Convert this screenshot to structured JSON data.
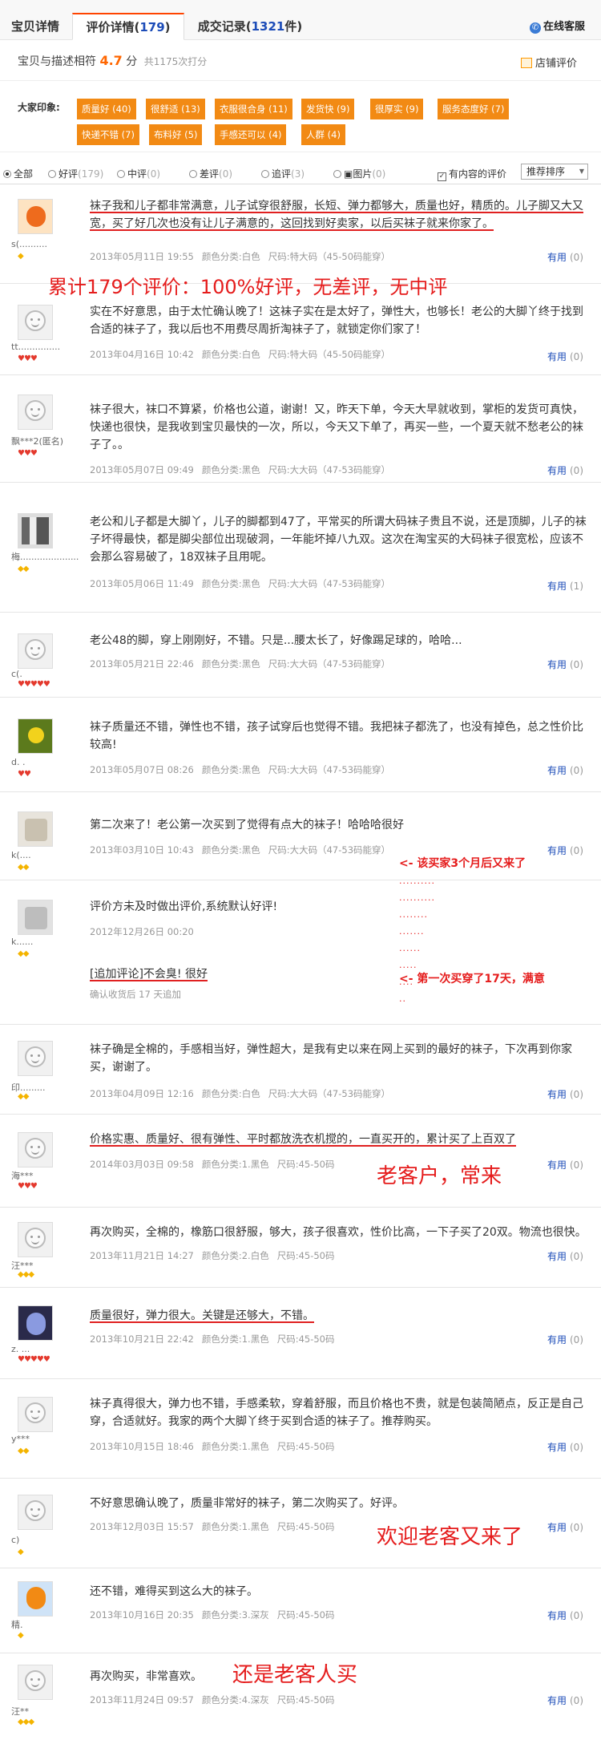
{
  "tabs": [
    {
      "label": "宝贝详情"
    },
    {
      "label": "评价详情",
      "count": "179"
    },
    {
      "label": "成交记录",
      "count": "1321",
      "suffix": "件"
    }
  ],
  "customer_service": "在线客服",
  "score": {
    "label": "宝贝与描述相符",
    "value": "4.7",
    "unit": "分",
    "total": "共1175次打分"
  },
  "shop_rating": "店铺评价",
  "impressions": {
    "label": "大家印象:",
    "tags": [
      "质量好 (40)",
      "很舒适 (13)",
      "衣服很合身 (11)",
      "发货快 (9)",
      "很厚实 (9)",
      "服务态度好 (7)",
      "快递不错 (7)",
      "布料好 (5)",
      "手感还可以 (4)",
      "人群 (4)"
    ]
  },
  "filter": {
    "options": [
      {
        "label": "全部",
        "count": ""
      },
      {
        "label": "好评",
        "count": "(179)"
      },
      {
        "label": "中评",
        "count": "(0)"
      },
      {
        "label": "差评",
        "count": "(0)"
      },
      {
        "label": "追评",
        "count": "(3)"
      },
      {
        "label": "图片",
        "count": "(0)"
      }
    ],
    "has_content": "有内容的评价",
    "sort": "推荐排序"
  },
  "useful_label": "有用",
  "reviews": [
    {
      "user": "s(..........",
      "lvl": "◆",
      "text": [
        "袜子我和儿子都非常满意，儿子试穿很舒服，长短、弹力都够大，质量也好，精质的。儿子脚又大又宽，买了好几次也没有让儿子满意的，这回找到好卖家，以后买袜子就来你家了。"
      ],
      "date": "2013年05月11日 19:55",
      "color": "颜色分类:白色",
      "size": "尺码:特大码（45-50码能穿）",
      "useful": "(0)"
    },
    {
      "user": "tt...............",
      "lvl": "♥♥♥",
      "text": [
        "实在不好意思，由于太忙确认晚了！这袜子实在是太好了，弹性大，也够长！老公的大脚丫终于找到合适的袜子了，我以后也不用费尽周折淘袜子了，就锁定你们家了！"
      ],
      "date": "2013年04月16日 10:42",
      "color": "颜色分类:白色",
      "size": "尺码:特大码（45-50码能穿）",
      "useful": "(0)"
    },
    {
      "user": "飘***2(匿名)",
      "lvl": "♥♥♥",
      "text": [
        "袜子很大，袜口不算紧，价格也公道，谢谢！又，昨天下单，今天大早就收到，掌柜的发货可真快，快递也很快，是我收到宝贝最快的一次，所以，今天又下单了，再买一些，一个夏天就不愁老公的袜子了。。"
      ],
      "date": "2013年05月07日 09:49",
      "color": "颜色分类:黑色",
      "size": "尺码:大大码（47-53码能穿）",
      "useful": "(0)"
    },
    {
      "user": "梅.....................",
      "lvl": "◆◆",
      "text": [
        "老公和儿子都是大脚丫，儿子的脚都到47了，平常买的所谓大码袜子贵且不说，还是顶脚，儿子的袜子坏得最快，都是脚尖部位出现破洞，一年能坏掉八九双。这次在淘宝买的大码袜子很宽松，应该不会那么容易破了，18双袜子且用呢。"
      ],
      "date": "2013年05月06日 11:49",
      "color": "颜色分类:黑色",
      "size": "尺码:大大码（47-53码能穿）",
      "useful": "(1)"
    },
    {
      "user": "c(.",
      "lvl": "♥♥♥♥♥",
      "text": [
        "老公48的脚，穿上刚刚好，不错。只是...腰太长了，好像踢足球的，哈哈..."
      ],
      "date": "2013年05月21日 22:46",
      "color": "颜色分类:黑色",
      "size": "尺码:大大码（47-53码能穿）",
      "useful": "(0)"
    },
    {
      "user": "d.       .",
      "lvl": "♥♥",
      "text": [
        "袜子质量还不错，弹性也不错，孩子试穿后也觉得不错。我把袜子都洗了，也没有掉色，总之性价比较高!"
      ],
      "date": "2013年05月07日 08:26",
      "color": "颜色分类:黑色",
      "size": "尺码:大大码（47-53码能穿）",
      "useful": "(0)"
    },
    {
      "user": "k(....",
      "lvl": "◆◆",
      "text": [
        "第二次来了！老公第一次买到了觉得有点大的袜子！哈哈哈很好"
      ],
      "date": "2013年03月10日 10:43",
      "color": "颜色分类:黑色",
      "size": "尺码:大大码（47-53码能穿）",
      "useful": "(0)"
    },
    {
      "user": "k......",
      "lvl": "◆◆",
      "text": [
        "评价方未及时做出评价,系统默认好评!"
      ],
      "date": "2012年12月26日 00:20",
      "color": "",
      "size": "",
      "useful": ""
    },
    {
      "user": "印.........",
      "lvl": "◆◆",
      "text": [
        "袜子确是全棉的，手感相当好，弹性超大，是我有史以来在网上买到的最好的袜子，下次再到你家买，谢谢了。"
      ],
      "date": "2013年04月09日 12:16",
      "color": "颜色分类:白色",
      "size": "尺码:大大码（47-53码能穿）",
      "useful": "(0)"
    },
    {
      "user": "海***",
      "lvl": "♥♥♥",
      "text": [
        "价格实惠、质量好、很有弹性、平时都放洗衣机搅的，一直买开的，累计买了上百双了"
      ],
      "date": "2014年03月03日 09:58",
      "color": "颜色分类:1.黑色",
      "size": "尺码:45-50码",
      "useful": "(0)"
    },
    {
      "user": "汪***",
      "lvl": "◆◆◆",
      "text": [
        "再次购买，全棉的，橡筋口很舒服，够大，孩子很喜欢，性价比高，一下子买了20双。物流也很快。"
      ],
      "date": "2013年11月21日 14:27",
      "color": "颜色分类:2.白色",
      "size": "尺码:45-50码",
      "useful": "(0)"
    },
    {
      "user": "z.    ...",
      "lvl": "♥♥♥♥♥",
      "text": [
        "质量很好，弹力很大。关键是还够大，不错。"
      ],
      "date": "2013年10月21日 22:42",
      "color": "颜色分类:1.黑色",
      "size": "尺码:45-50码",
      "useful": "(0)"
    },
    {
      "user": "y***",
      "lvl": "◆◆",
      "text": [
        "袜子真得很大，弹力也不错，手感柔软，穿着舒服，而且价格也不贵，就是包装简陋点，反正是自己穿，合适就好。我家的两个大脚丫终于买到合适的袜子了。推荐购买。"
      ],
      "date": "2013年10月15日 18:46",
      "color": "颜色分类:1.黑色",
      "size": "尺码:45-50码",
      "useful": "(0)"
    },
    {
      "user": "c)",
      "lvl": "◆",
      "text": [
        "不好意思确认晚了，质量非常好的袜子，第二次购买了。好评。"
      ],
      "date": "2013年12月03日 15:57",
      "color": "颜色分类:1.黑色",
      "size": "尺码:45-50码",
      "useful": "(0)"
    },
    {
      "user": "精.",
      "lvl": "◆",
      "text": [
        "还不错，难得买到这么大的袜子。"
      ],
      "date": "2013年10月16日 20:35",
      "color": "颜色分类:3.深灰",
      "size": "尺码:45-50码",
      "useful": "(0)"
    },
    {
      "user": "汪**",
      "lvl": "◆◆◆",
      "text": [
        "再次购买，非常喜欢。"
      ],
      "date": "2013年11月24日 09:57",
      "color": "颜色分类:4.深灰",
      "size": "尺码:45-50码",
      "useful": "(0)"
    }
  ],
  "append": {
    "text": "[追加评论]不会臭! 很好",
    "note": "确认收货后 17 天追加"
  },
  "annotations": {
    "a1": "累计179个评价：100%好评，无差评，无中评",
    "a2": "<- 该买家3个月后又来了",
    "a3": "<- 第一次买穿了17天，满意",
    "a4": "老客户，常来",
    "a5": "欢迎老客又来了",
    "a6": "还是老客人买"
  }
}
